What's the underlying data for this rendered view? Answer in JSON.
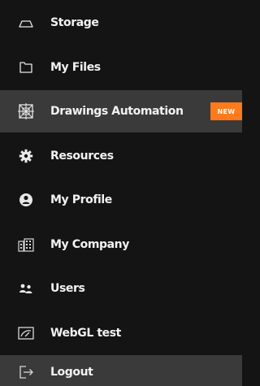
{
  "menu": {
    "items": [
      {
        "label": "Storage",
        "icon": "cloud-icon"
      },
      {
        "label": "My Files",
        "icon": "folder-icon"
      },
      {
        "label": "Drawings Automation",
        "icon": "drawings-automation-icon",
        "badge": "NEW",
        "active": true
      },
      {
        "label": "Resources",
        "icon": "gear-icon"
      },
      {
        "label": "My Profile",
        "icon": "profile-icon"
      },
      {
        "label": "My Company",
        "icon": "building-icon"
      },
      {
        "label": "Users",
        "icon": "users-icon"
      },
      {
        "label": "WebGL test",
        "icon": "webgl-icon"
      },
      {
        "label": "Logout",
        "icon": "logout-icon"
      }
    ]
  },
  "colors": {
    "background": "#141414",
    "active_background": "#3a3a3a",
    "text": "#f2f2f2",
    "badge": "#ff7a1a"
  }
}
